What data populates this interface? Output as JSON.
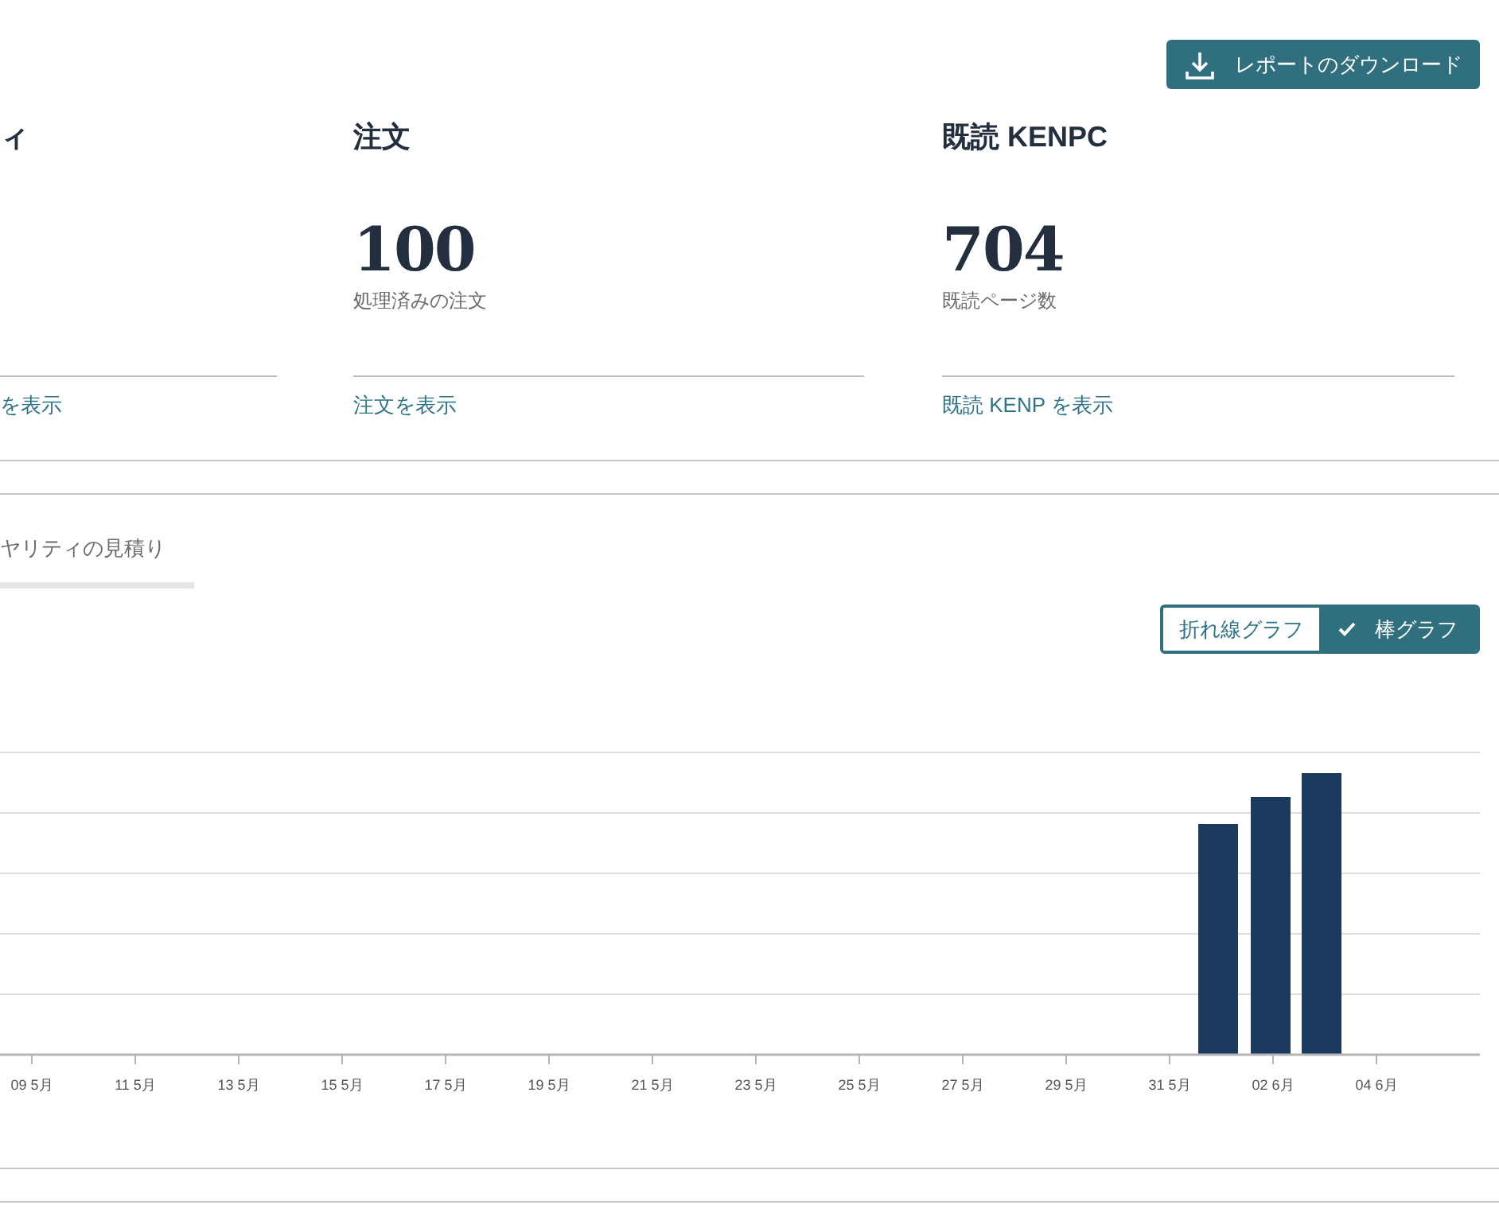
{
  "download_button": {
    "label": "レポートのダウンロード"
  },
  "cards": [
    {
      "title": "ィ",
      "link": "を表示"
    },
    {
      "title": "注文",
      "value": "100",
      "caption": "処理済みの注文",
      "link": "注文を表示"
    },
    {
      "title": "既読 KENPC",
      "value": "704",
      "caption": "既読ページ数",
      "link": "既読 KENP を表示"
    }
  ],
  "tabs": [
    {
      "label": "ヤリティの見積り",
      "selected": false
    }
  ],
  "chart_toggle": [
    {
      "label": "折れ線グラフ",
      "selected": false
    },
    {
      "label": "棒グラフ",
      "selected": true
    }
  ],
  "chart": {
    "x_tick_labels": [
      "09 5月",
      "11 5月",
      "13 5月",
      "15 5月",
      "17 5月",
      "19 5月",
      "21 5月",
      "23 5月",
      "25 5月",
      "27 5月",
      "29 5月",
      "31 5月",
      "02 6月",
      "04 6月"
    ]
  }
}
